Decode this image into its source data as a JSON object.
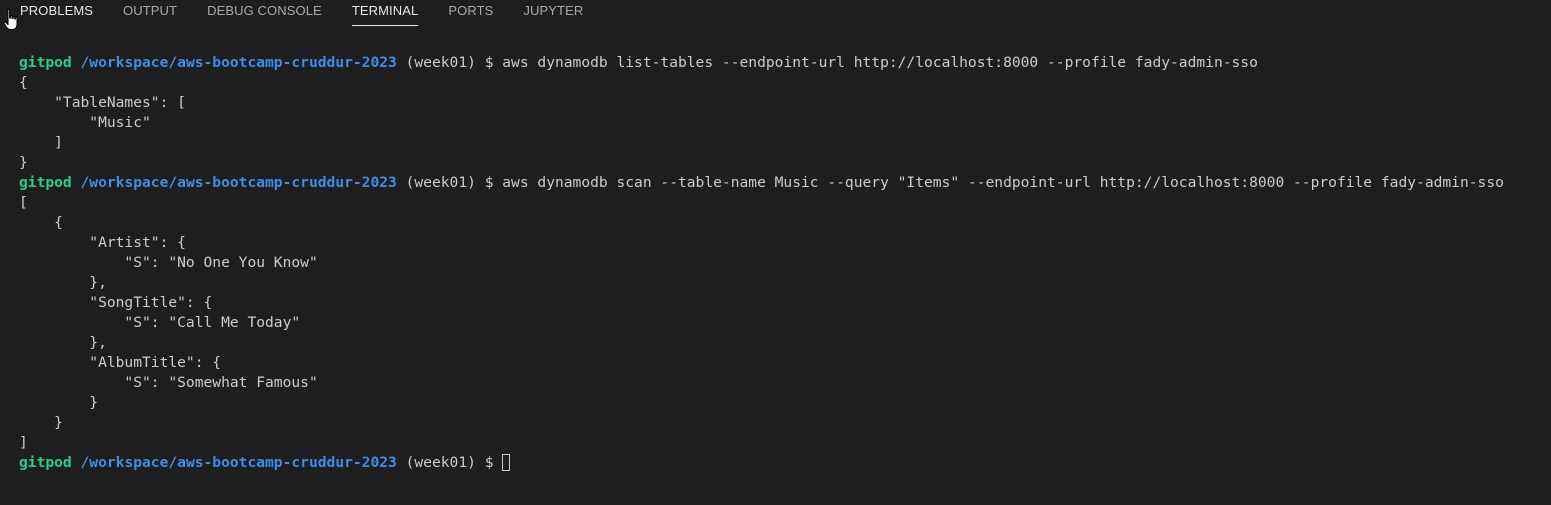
{
  "panel": {
    "tabs": [
      {
        "label": "PROBLEMS"
      },
      {
        "label": "OUTPUT"
      },
      {
        "label": "DEBUG CONSOLE"
      },
      {
        "label": "TERMINAL"
      },
      {
        "label": "PORTS"
      },
      {
        "label": "JUPYTER"
      }
    ],
    "active_tab": "TERMINAL"
  },
  "terminal": {
    "prompt": {
      "user": "gitpod",
      "path": "/workspace/aws-bootcamp-cruddur-2023",
      "branch": " (week01) $ "
    },
    "commands": [
      "aws dynamodb list-tables --endpoint-url http://localhost:8000 --profile fady-admin-sso",
      "aws dynamodb scan --table-name Music --query \"Items\" --endpoint-url http://localhost:8000 --profile fady-admin-sso"
    ],
    "output1": [
      "{",
      "    \"TableNames\": [",
      "        \"Music\"",
      "    ]",
      "}"
    ],
    "output2": [
      "[",
      "    {",
      "        \"Artist\": {",
      "            \"S\": \"No One You Know\"",
      "        },",
      "        \"SongTitle\": {",
      "            \"S\": \"Call Me Today\"",
      "        },",
      "        \"AlbumTitle\": {",
      "            \"S\": \"Somewhat Famous\"",
      "        }",
      "    }",
      "]"
    ]
  },
  "colors": {
    "background": "#1e1e1e",
    "text": "#cccccc",
    "prompt_user": "#23d18b",
    "prompt_path": "#3b8eea"
  }
}
